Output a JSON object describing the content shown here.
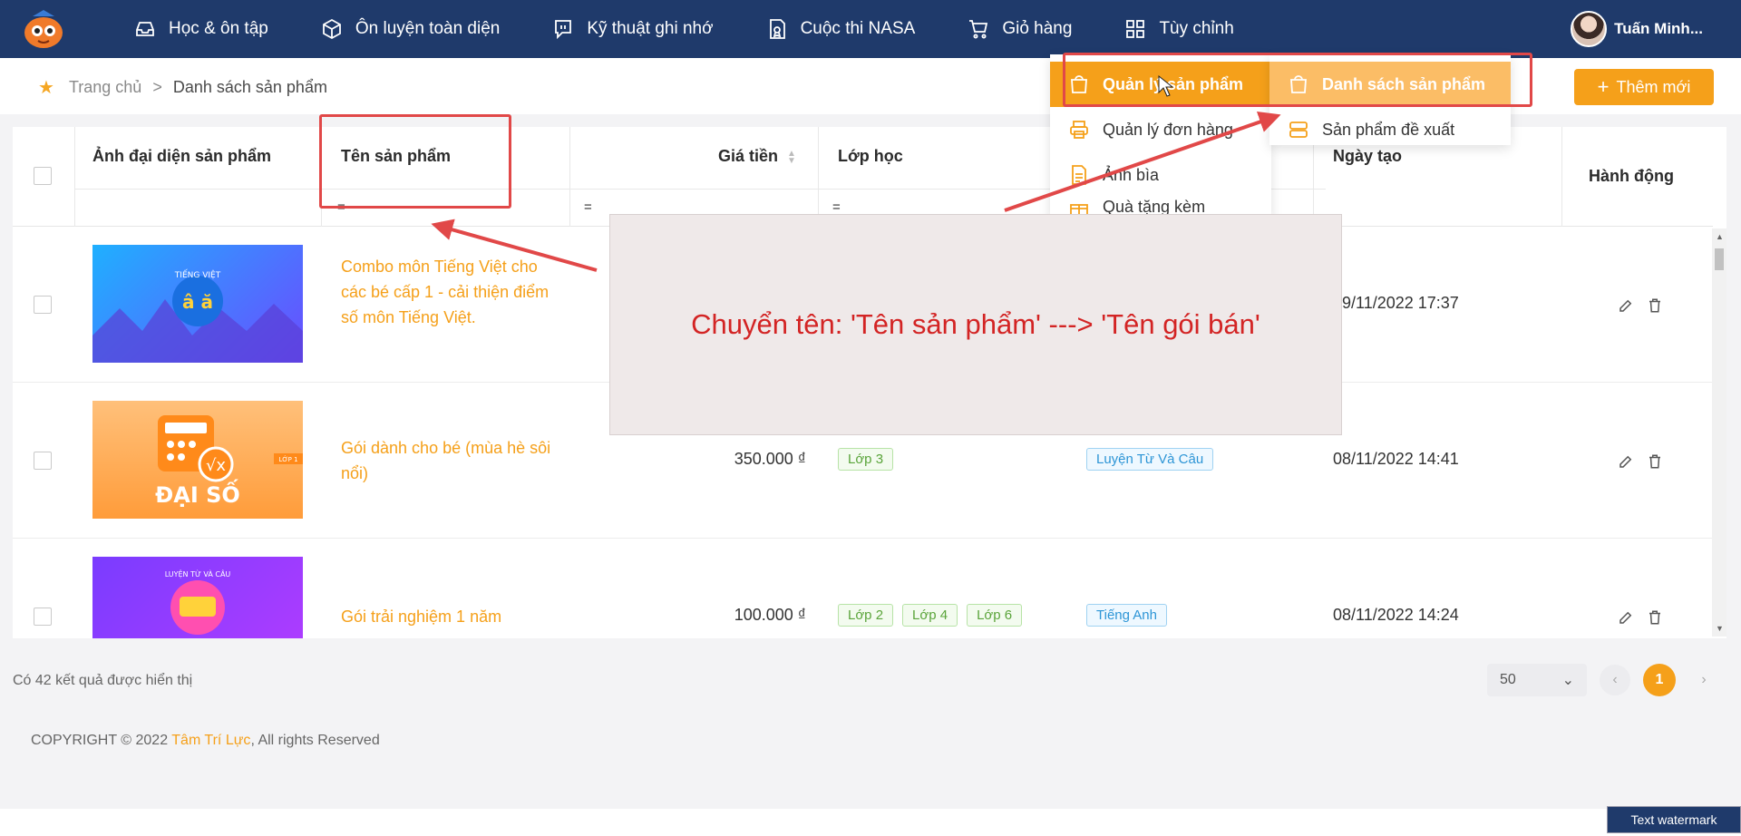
{
  "nav": {
    "items": [
      {
        "label": "Học & ôn tập",
        "icon": "inbox-icon"
      },
      {
        "label": "Ôn luyện toàn diện",
        "icon": "cube-icon"
      },
      {
        "label": "Kỹ thuật ghi nhớ",
        "icon": "message-icon"
      },
      {
        "label": "Cuộc thi NASA",
        "icon": "certificate-icon"
      },
      {
        "label": "Giỏ hàng",
        "icon": "cart-icon"
      },
      {
        "label": "Tùy chỉnh",
        "icon": "grid-icon"
      }
    ],
    "user_name": "Tuấn Minh..."
  },
  "breadcrumb": {
    "home": "Trang chủ",
    "separator": ">",
    "current": "Danh sách sản phẩm"
  },
  "add_button": {
    "label": "Thêm mới"
  },
  "table": {
    "headers": {
      "thumbnail": "Ảnh đại diện sản phẩm",
      "name": "Tên sản phẩm",
      "price": "Giá tiền",
      "grade": "Lớp học",
      "created": "Ngày tạo",
      "actions": "Hành động"
    },
    "filter_symbol": "=",
    "rows": [
      {
        "thumb_text": "TIẾNG VIỆT",
        "name": "Combo môn Tiếng Việt cho các bé cấp 1 - cải thiện điểm số môn Tiếng Việt.",
        "price": "",
        "grades": [],
        "subject": "",
        "created": "09/11/2022 17:37"
      },
      {
        "thumb_text": "ĐẠI SỐ",
        "thumb_badge": "LỚP 1",
        "name": "Gói dành cho bé (mùa hè sôi nổi)",
        "price": "350.000 ₫",
        "grades": [
          "Lớp 3"
        ],
        "subject": "Luyện Từ Và Câu",
        "created": "08/11/2022 14:41"
      },
      {
        "thumb_text": "LUYỆN TỪ VÀ CÂU",
        "name": "Gói trải nghiệm 1 năm",
        "price": "100.000 ₫",
        "grades": [
          "Lớp 2",
          "Lớp 4",
          "Lớp 6"
        ],
        "subject": "Tiếng Anh",
        "created": "08/11/2022 14:24"
      }
    ]
  },
  "footer": {
    "result_count": "Có 42 kết quả được hiển thị",
    "page_size": "50",
    "current_page": "1",
    "copyright_prefix": "COPYRIGHT © 2022 ",
    "copyright_brand": "Tâm Trí Lực",
    "copyright_suffix": ", All rights Reserved"
  },
  "dropdown": {
    "left_items": [
      {
        "label": "Quản lý sản phẩm",
        "active": true
      },
      {
        "label": "Quản lý đơn hàng",
        "has_arrow": true
      },
      {
        "label": "Ảnh bìa"
      },
      {
        "label": "Quà tặng kèm"
      }
    ],
    "right_items": [
      {
        "label": "Danh sách sản phẩm",
        "active": true
      },
      {
        "label": "Sản phẩm đề xuất"
      }
    ]
  },
  "annotation": {
    "text": "Chuyển tên: 'Tên sản phẩm' ---> 'Tên gói bán'"
  },
  "watermark": "Text watermark",
  "colors": {
    "navbar": "#1f3a6b",
    "accent": "#f5a01a",
    "annotation_red": "#e14848"
  }
}
